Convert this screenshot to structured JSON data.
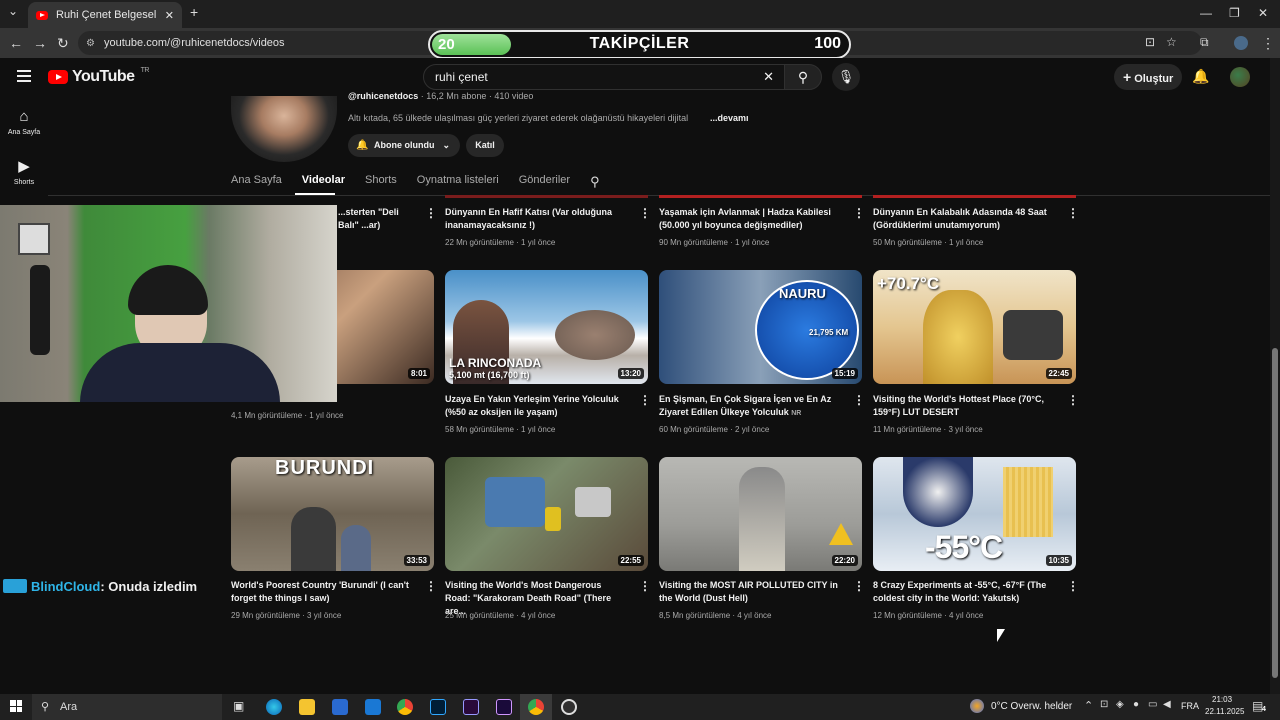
{
  "browser": {
    "tab_title": "Ruhi Çenet Belgeselleri - YouTube",
    "url": "youtube.com/@ruhicenetdocs/videos"
  },
  "overlay": {
    "current": "20",
    "label": "TAKİPÇİLER",
    "goal": "100",
    "progress": 0.2
  },
  "youtube": {
    "logo": "YouTube",
    "region": "TR",
    "search_value": "ruhi çenet",
    "create_label": "Oluştur",
    "guide": [
      {
        "label": "Ana Sayfa",
        "icon": "home-icon"
      },
      {
        "label": "Shorts",
        "icon": "shorts-icon"
      }
    ]
  },
  "channel": {
    "handle": "@ruhicenetdocs",
    "stats": " · 16,2 Mn abone · 410 video",
    "description": "Altı kıtada, 65 ülkede ulaşılması güç yerleri ziyaret ederek olağanüstü hikayeleri dijital",
    "more": "...devamı",
    "subscribed_label": "Abone olundu",
    "join_label": "Katıl",
    "tabs": [
      "Ana Sayfa",
      "Videolar",
      "Shorts",
      "Oynatma listeleri",
      "Gönderiler"
    ]
  },
  "videos_row1": [
    {
      "title": "...sterten \"Deli Balı\" ...ar)",
      "meta": ""
    },
    {
      "title": "Dünyanın En Hafif Katısı (Var olduğuna inanamayacaksınız !)",
      "meta": "22 Mn görüntüleme · 1 yıl önce"
    },
    {
      "title": "Yaşamak için Avlanmak | Hadza Kabilesi (50.000 yıl boyunca değişmediler)",
      "meta": "90 Mn görüntüleme · 1 yıl önce"
    },
    {
      "title": "Dünyanın En Kalabalık Adasında 48 Saat (Gördüklerimi unutamıyorum)",
      "meta": "50 Mn görüntüleme · 1 yıl önce"
    }
  ],
  "videos_row2": [
    {
      "title": "",
      "meta": "4,1 Mn görüntüleme · 1 yıl önce",
      "duration": "8:01"
    },
    {
      "title": "Uzaya En Yakın Yerleşim Yerine Yolculuk (%50 az oksijen ile yaşam)",
      "meta": "58 Mn görüntüleme · 1 yıl önce",
      "duration": "13:20",
      "overlay": "LA RINCONADA",
      "overlay2": "5,100 mt (16,700 ft)"
    },
    {
      "title": "En Şişman, En Çok Sigara İçen ve En Az Ziyaret Edilen Ülkeye Yolculuk",
      "badge": "NR",
      "meta": "60 Mn görüntüleme · 2 yıl önce",
      "duration": "15:19",
      "overlay": "NAURU",
      "overlay2": "21,795 KM"
    },
    {
      "title": "Visiting the World's Hottest Place (70°C, 159°F) LUT DESERT",
      "meta": "11 Mn görüntüleme · 3 yıl önce",
      "duration": "22:45",
      "overlay": "+70.7°C"
    }
  ],
  "videos_row3": [
    {
      "title": "World's Poorest Country 'Burundi' (I can't forget the things I saw)",
      "meta": "29 Mn görüntüleme · 3 yıl önce",
      "duration": "33:53",
      "overlay": "BURUNDI"
    },
    {
      "title": "Visiting the World's Most Dangerous Road: \"Karakoram Death Road\" (There are...",
      "meta": "25 Mn görüntüleme · 4 yıl önce",
      "duration": "22:55"
    },
    {
      "title": "Visiting the MOST AIR POLLUTED CITY in the World (Dust Hell)",
      "meta": "8,5 Mn görüntüleme · 4 yıl önce",
      "duration": "22:20"
    },
    {
      "title": "8 Crazy Experiments at -55°C, -67°F (The coldest city in the World: Yakutsk)",
      "meta": "12 Mn görüntüleme · 4 yıl önce",
      "duration": "10:35",
      "overlay": "-55°C"
    }
  ],
  "chat": {
    "user": "BlindCloud",
    "message": ": Onuda izledim"
  },
  "taskbar": {
    "search": "Ara",
    "weather": "0°C  Overw. helder",
    "lang": "FRA",
    "time": "21:03",
    "date": "22.11.2025",
    "notif_count": "4"
  },
  "colors": {
    "accent_red": "#ff0000",
    "progress_green": "#5bc156",
    "chat_name": "#2fb5e8"
  }
}
